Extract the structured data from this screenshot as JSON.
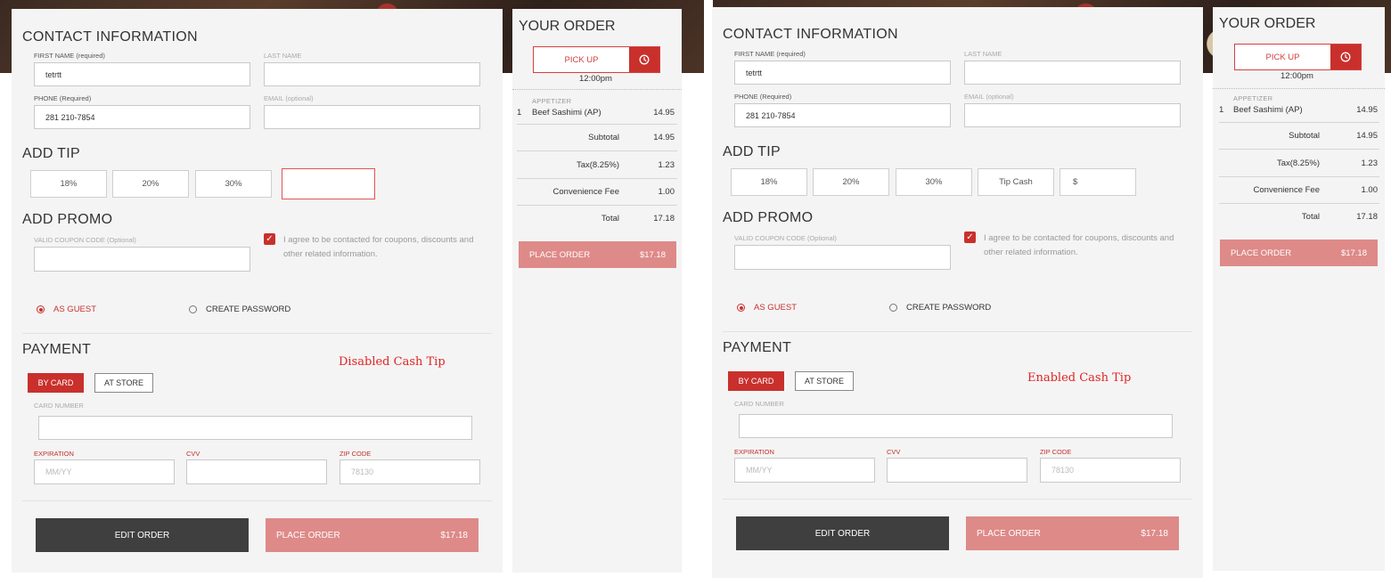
{
  "contact": {
    "title": "CONTACT INFORMATION",
    "first_name_label": "FIRST NAME (required)",
    "last_name_label": "LAST NAME",
    "first_name_value": "tetrtt",
    "phone_label": "PHONE (Required)",
    "email_label": "EMAIL (optional)",
    "phone_value": "281 210-7854"
  },
  "tip": {
    "title": "ADD TIP",
    "options": [
      "18%",
      "20%",
      "30%"
    ],
    "cash_label": "Tip Cash",
    "cash_symbol": "$"
  },
  "promo": {
    "title": "ADD PROMO",
    "coupon_label": "VALID COUPON CODE (Optional)",
    "agree_text": "I agree to be contacted for coupons, discounts and other related information."
  },
  "account": {
    "guest_label": "AS GUEST",
    "password_label": "CREATE PASSWORD"
  },
  "payment": {
    "title": "PAYMENT",
    "by_card": "BY CARD",
    "at_store": "AT STORE",
    "card_number_label": "CARD NUMBER",
    "expiration_label": "EXPIRATION",
    "cvv_label": "CVV",
    "zip_label": "ZIP CODE",
    "expiration_placeholder": "MM/YY",
    "zip_placeholder": "78130"
  },
  "actions": {
    "edit_order": "EDIT ORDER",
    "place_order": "PLACE ORDER",
    "place_order_amount": "$17.18"
  },
  "notes": {
    "left": "Disabled Cash Tip",
    "right": "Enabled Cash Tip"
  },
  "order": {
    "title": "YOUR ORDER",
    "mode": "PICK UP",
    "time": "12:00pm",
    "category": "APPETIZER",
    "item_qty": "1",
    "item_name": "Beef Sashimi (AP)",
    "item_price": "14.95",
    "subtotal_label": "Subtotal",
    "subtotal": "14.95",
    "tax_label": "Tax(8.25%)",
    "tax": "1.23",
    "fee_label": "Convenience Fee",
    "fee": "1.00",
    "total_label": "Total",
    "total": "17.18",
    "place_order": "PLACE ORDER",
    "place_order_amount": "$17.18"
  },
  "colors": {
    "accent": "#c9302c",
    "place_order_disabled": "#de8a88",
    "panel": "#f4f4f4",
    "note": "#e02424"
  }
}
